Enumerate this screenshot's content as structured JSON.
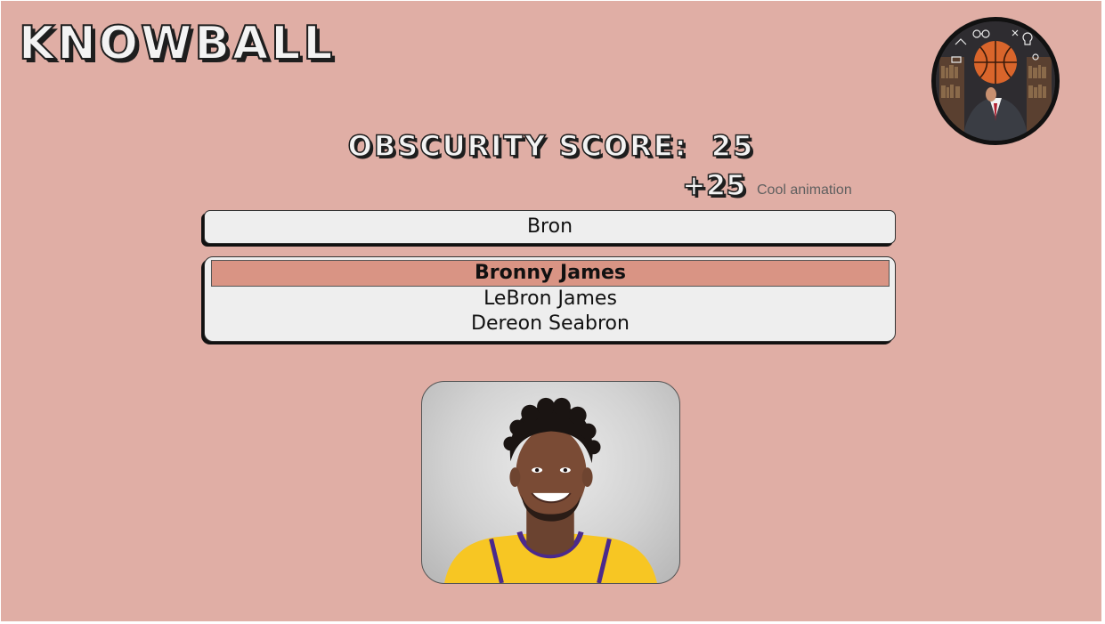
{
  "app": {
    "title": "KNOWBALL"
  },
  "score": {
    "label": "OBSCURITY SCORE:",
    "value": "25",
    "gain": "+25",
    "note": "Cool animation"
  },
  "search": {
    "value": "Bron"
  },
  "suggestions": [
    {
      "label": "Bronny James",
      "selected": true
    },
    {
      "label": "LeBron James",
      "selected": false
    },
    {
      "label": "Dereon Seabron",
      "selected": false
    }
  ],
  "colors": {
    "background": "#e0aea5",
    "panel": "#eeeeee",
    "highlight": "#d99484",
    "jersey": "#f7c623",
    "trim": "#4b2a8c"
  },
  "icons": {
    "avatar": "basketball-head-professor-avatar",
    "photo": "player-headshot-photo"
  }
}
